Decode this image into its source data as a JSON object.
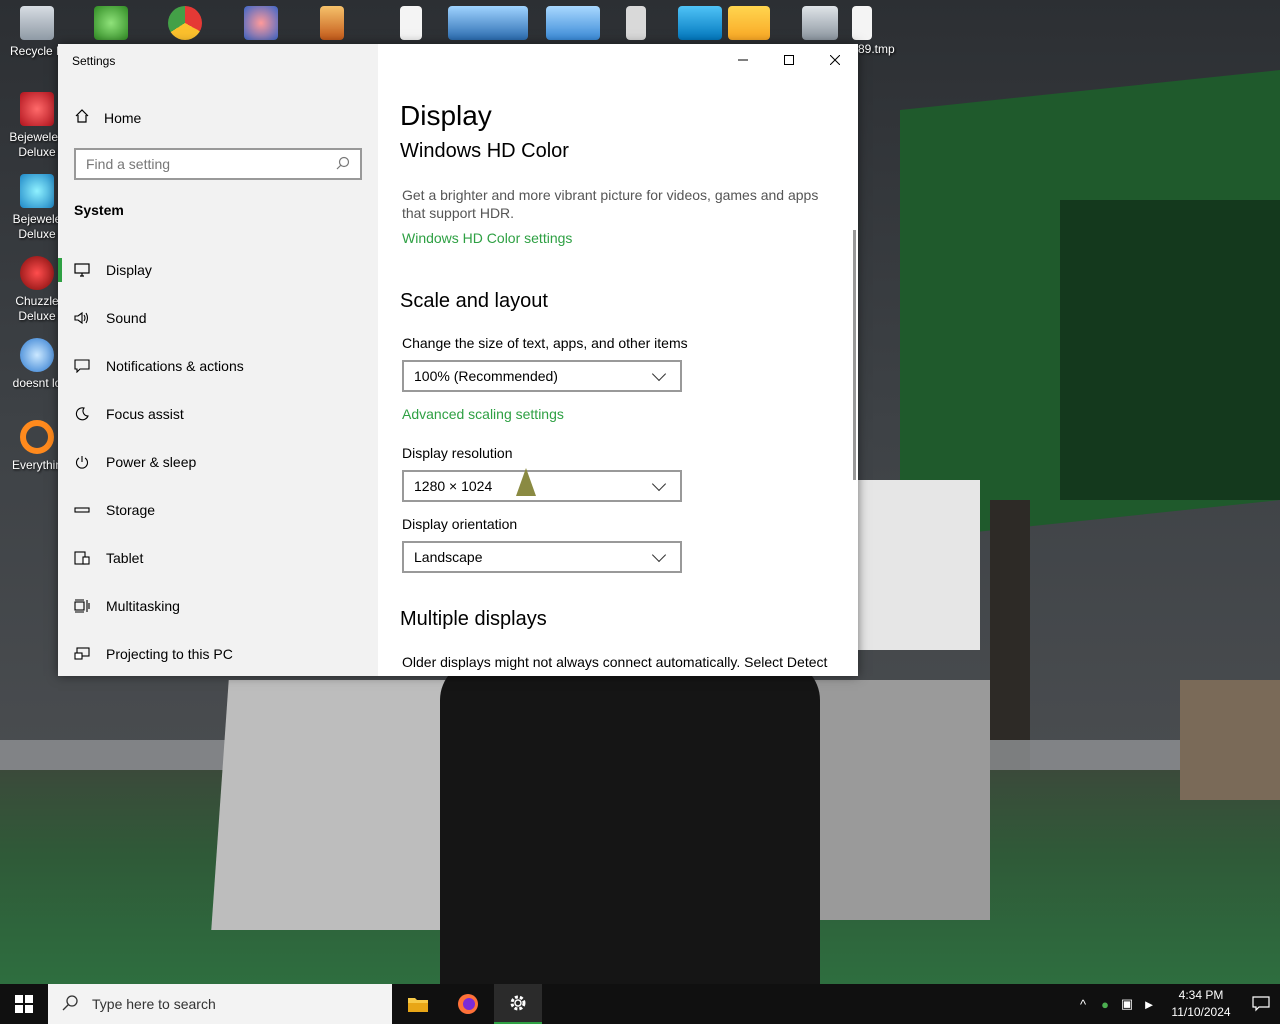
{
  "desktop": {
    "icons": [
      {
        "label": "Recycle B",
        "icon": "recycle-bin-icon"
      },
      {
        "label": "Bejeweled Deluxe",
        "icon": "bejeweled-icon"
      },
      {
        "label": "Bejewele Deluxe",
        "icon": "bejeweled-icon"
      },
      {
        "label": "Chuzzle Deluxe",
        "icon": "chuzzle-icon"
      },
      {
        "label": "doesnt lo",
        "icon": "app-icon"
      },
      {
        "label": "Everythin",
        "icon": "everything-icon"
      }
    ],
    "top_file_label": "89.tmp"
  },
  "settings": {
    "app_title": "Settings",
    "home_label": "Home",
    "search_placeholder": "Find a setting",
    "section_label": "System",
    "nav_items": [
      {
        "label": "Display",
        "icon": "monitor-icon"
      },
      {
        "label": "Sound",
        "icon": "speaker-icon"
      },
      {
        "label": "Notifications & actions",
        "icon": "notification-icon"
      },
      {
        "label": "Focus assist",
        "icon": "moon-icon"
      },
      {
        "label": "Power & sleep",
        "icon": "power-icon"
      },
      {
        "label": "Storage",
        "icon": "storage-icon"
      },
      {
        "label": "Tablet",
        "icon": "tablet-icon"
      },
      {
        "label": "Multitasking",
        "icon": "multitasking-icon"
      },
      {
        "label": "Projecting to this PC",
        "icon": "projecting-icon"
      }
    ],
    "active_nav": "Display",
    "page_title": "Display",
    "hdr_heading": "Windows HD Color",
    "hdr_desc": "Get a brighter and more vibrant picture for videos, games and apps that support HDR.",
    "hdr_link": "Windows HD Color settings",
    "scale_heading": "Scale and layout",
    "scale_label": "Change the size of text, apps, and other items",
    "scale_value": "100% (Recommended)",
    "scale_link": "Advanced scaling settings",
    "resolution_label": "Display resolution",
    "resolution_value": "1280 × 1024",
    "orientation_label": "Display orientation",
    "orientation_value": "Landscape",
    "multi_heading": "Multiple displays",
    "multi_desc": "Older displays might not always connect automatically. Select Detect",
    "accent_color": "#2ea043"
  },
  "taskbar": {
    "search_placeholder": "Type here to search",
    "apps": [
      {
        "name": "File Explorer",
        "icon": "folder-icon"
      },
      {
        "name": "Firefox",
        "icon": "firefox-icon"
      },
      {
        "name": "Settings",
        "icon": "gear-icon"
      }
    ],
    "clock_time": "4:34 PM",
    "clock_date": "11/10/2024"
  }
}
